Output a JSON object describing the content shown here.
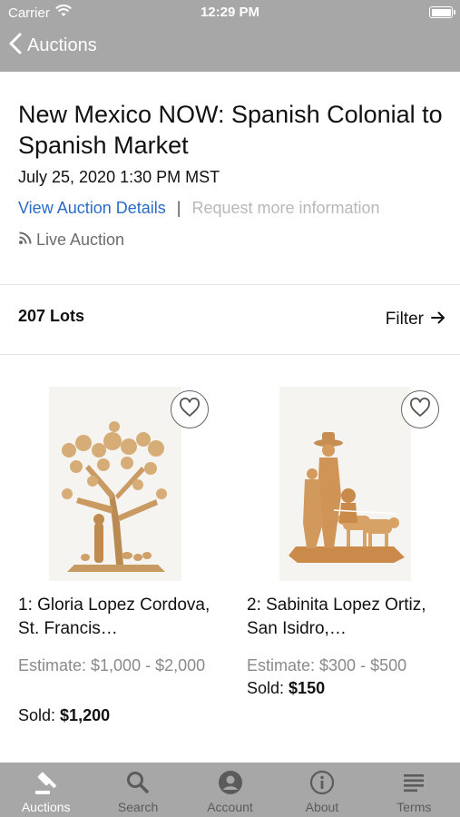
{
  "status_bar": {
    "carrier": "Carrier",
    "time": "12:29 PM"
  },
  "nav": {
    "back_label": "Auctions"
  },
  "auction": {
    "title": "New Mexico NOW: Spanish Colonial to Spanish Market",
    "date": "July 25, 2020 1:30 PM MST",
    "view_details": "View Auction Details",
    "separator": "|",
    "request_info": "Request more information",
    "type": "Live Auction"
  },
  "lots_header": {
    "count": "207 Lots",
    "filter_label": "Filter"
  },
  "lots": [
    {
      "name": "1: Gloria Lopez Cordova, St. Francis…",
      "estimate": "Estimate: $1,000 - $2,000",
      "sold_label": "Sold:",
      "sold_value": "$1,200"
    },
    {
      "name": "2: Sabinita Lopez Ortiz, San Isidro,…",
      "estimate": "Estimate: $300 - $500",
      "sold_label": "Sold:",
      "sold_value": "$150"
    }
  ],
  "tabs": [
    {
      "label": "Auctions",
      "icon": "gavel-icon",
      "active": true
    },
    {
      "label": "Search",
      "icon": "search-icon",
      "active": false
    },
    {
      "label": "Account",
      "icon": "account-icon",
      "active": false
    },
    {
      "label": "About",
      "icon": "info-icon",
      "active": false
    },
    {
      "label": "Terms",
      "icon": "terms-icon",
      "active": false
    }
  ],
  "colors": {
    "bar_gray": "#a7a7a7",
    "link_blue": "#2a6bc8",
    "muted_text": "#8a8a8a",
    "disabled_link": "#b8b8b8"
  }
}
